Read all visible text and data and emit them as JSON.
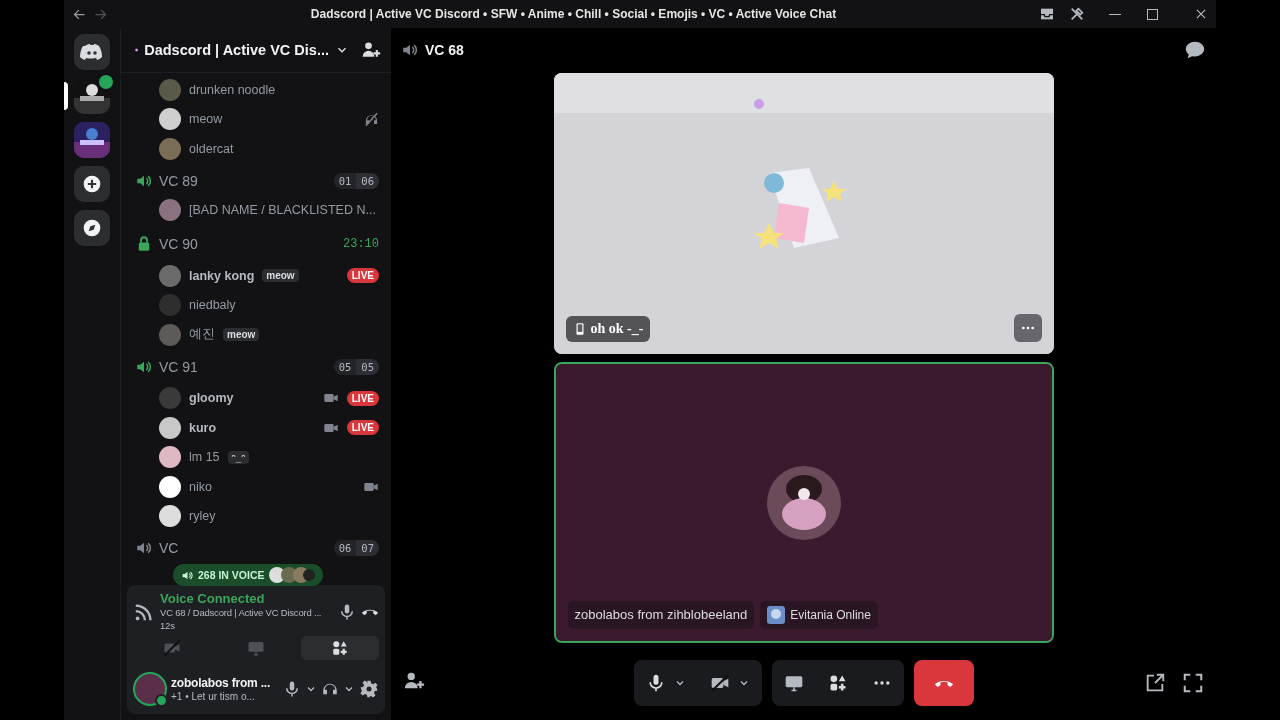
{
  "window": {
    "title": "Dadscord | Active VC Discord • SFW • Anime • Chill • Social • Emojis • VC • Active Voice Chat"
  },
  "servers": [
    {
      "kind": "home",
      "selected": false,
      "in_voice": false
    },
    {
      "kind": "picture",
      "selected": true,
      "in_voice": true
    },
    {
      "kind": "picture",
      "selected": false,
      "in_voice": false
    },
    {
      "kind": "add",
      "selected": false,
      "in_voice": false
    },
    {
      "kind": "discover",
      "selected": false,
      "in_voice": false
    }
  ],
  "server_header": {
    "name": "Dadscord | Active VC Dis..."
  },
  "top_members": [
    {
      "name": "drunken noodle",
      "camera": false,
      "deafened": false
    },
    {
      "name": "meow",
      "camera": false,
      "deafened": true
    },
    {
      "name": "oldercat",
      "camera": false,
      "deafened": false
    }
  ],
  "channels": [
    {
      "name": "VC 89",
      "kind": "voice",
      "count": "01",
      "limit": "06",
      "members": [
        {
          "name": "[BAD NAME / BLACKLISTED N...",
          "camera": false,
          "deafened": false
        }
      ]
    },
    {
      "name": "VC 90",
      "kind": "locked",
      "timer": "23:10",
      "members": [
        {
          "name": "lanky kong",
          "tag": "meow",
          "badge": "LIVE",
          "camera": false,
          "deafened": false
        },
        {
          "name": "niedbaly",
          "camera": false,
          "deafened": false
        },
        {
          "name": "예진",
          "tag": "meow",
          "camera": false,
          "deafened": false
        }
      ]
    },
    {
      "name": "VC 91",
      "kind": "voice",
      "count": "05",
      "limit": "05",
      "members": [
        {
          "name": "gloomy",
          "badge": "LIVE",
          "camera": true,
          "deafened": false
        },
        {
          "name": "kuro",
          "badge": "LIVE",
          "camera": true,
          "deafened": false
        },
        {
          "name": "lm 15",
          "tag": "ᵔ_ᵔ",
          "camera": false,
          "deafened": false
        },
        {
          "name": "niko",
          "camera": true,
          "deafened": false
        },
        {
          "name": "ryley",
          "camera": false,
          "deafened": false
        }
      ]
    },
    {
      "name": "VC",
      "kind": "voice-idle",
      "count": "06",
      "limit": "07"
    }
  ],
  "voice_pill": {
    "text": "268 IN VOICE"
  },
  "voice_panel": {
    "status": "Voice Connected",
    "channel": "VC 68 / Dadscord | Active VC Discord ...",
    "elapsed": "12s",
    "activities_selected": true
  },
  "user": {
    "name": "zobolabos from ...",
    "status": "+1 • Let ur tism o..."
  },
  "main": {
    "channel": "VC 68"
  },
  "tiles": [
    {
      "kind": "stream",
      "label": "oh ok -_-",
      "speaking": false
    },
    {
      "kind": "avatar",
      "label": "zobolabos from zihblobeeland",
      "speaking": true,
      "activity": "Evitania Online"
    }
  ]
}
